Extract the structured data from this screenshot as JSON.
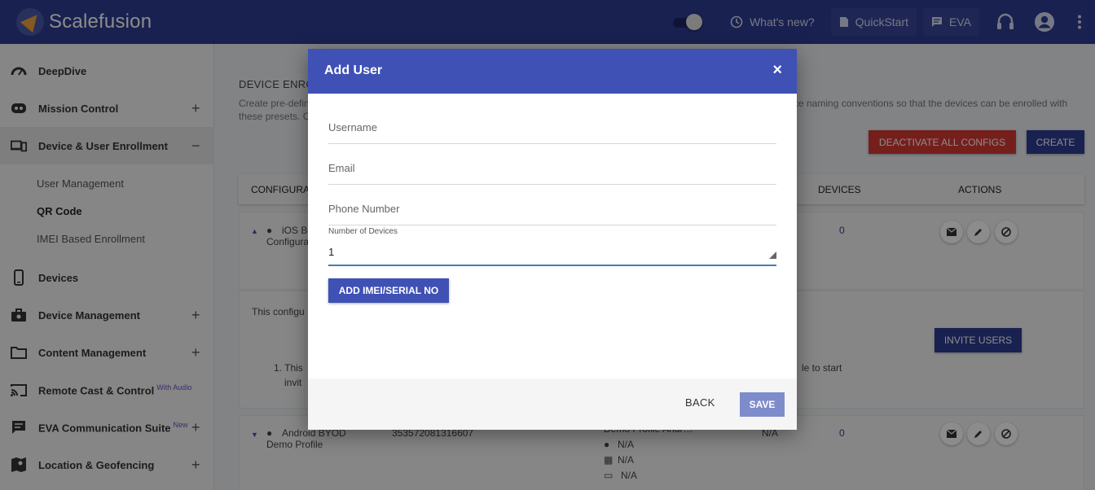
{
  "topbar": {
    "brand": "Scalefusion",
    "whats_new": "What's new?",
    "quickstart": "QuickStart",
    "eva": "EVA"
  },
  "sidebar": {
    "items": [
      {
        "label": "DeepDive",
        "icon": "gauge-icon",
        "toggle": ""
      },
      {
        "label": "Mission Control",
        "icon": "mission-control-icon",
        "toggle": "+"
      },
      {
        "label": "Device & User Enrollment",
        "icon": "devices-enroll-icon",
        "toggle": "−"
      },
      {
        "label": "Devices",
        "icon": "phone-icon",
        "toggle": ""
      },
      {
        "label": "Device Management",
        "icon": "briefcase-icon",
        "toggle": "+"
      },
      {
        "label": "Content Management",
        "icon": "folder-icon",
        "toggle": "+"
      },
      {
        "label": "Remote Cast & Control",
        "sup": "With Audio",
        "icon": "cast-icon",
        "toggle": ""
      },
      {
        "label": "EVA Communication Suite",
        "sup": "New",
        "icon": "chat-icon",
        "toggle": "+"
      },
      {
        "label": "Location & Geofencing",
        "icon": "map-icon",
        "toggle": "+"
      }
    ],
    "subitems": [
      "User Management",
      "QR Code",
      "IMEI Based Enrollment"
    ]
  },
  "page": {
    "section_title": "DEVICE ENRO",
    "description": "Create pre-defin… ce naming conventions so that the devices can be enrolled with these presets. C",
    "desc_line1_left": "Create pre-defin",
    "desc_line1_right": "ce naming conventions so that the devices can be enrolled with",
    "desc_line2": "these presets. C",
    "deactivate_label": "DEACTIVATE ALL CONFIGS",
    "create_label": "CREATE",
    "columns": {
      "config": "CONFIGURAT",
      "devices": "DEVICES",
      "actions": "ACTIONS"
    },
    "row1": {
      "name_line1": "iOS B",
      "name_line2": "Configura",
      "devices": "0"
    },
    "expanded": {
      "text": "This configu",
      "step1": "1. This",
      "step1_cont": "invit",
      "step_right": "le to start"
    },
    "invite_label": "INVITE USERS",
    "row2": {
      "name_line1": "Android BYOD",
      "name_line2": "Demo Profile",
      "code": "353572081316607",
      "profile": "Demo Profile Andr…",
      "apple": "N/A",
      "windows": "N/A",
      "mac": "N/A",
      "col4": "N/A",
      "devices": "0"
    }
  },
  "modal": {
    "title": "Add User",
    "close": "×",
    "username_placeholder": "Username",
    "email_placeholder": "Email",
    "phone_placeholder": "Phone Number",
    "devices_label": "Number of Devices",
    "devices_value": "1",
    "add_imei_label": "ADD IMEI/SERIAL NO",
    "back_label": "BACK",
    "save_label": "SAVE"
  },
  "colors": {
    "topbar": "#2f3c93",
    "modal_header": "#3f51b5",
    "danger": "#d53a35",
    "save_disabled": "#7f8ccc"
  }
}
